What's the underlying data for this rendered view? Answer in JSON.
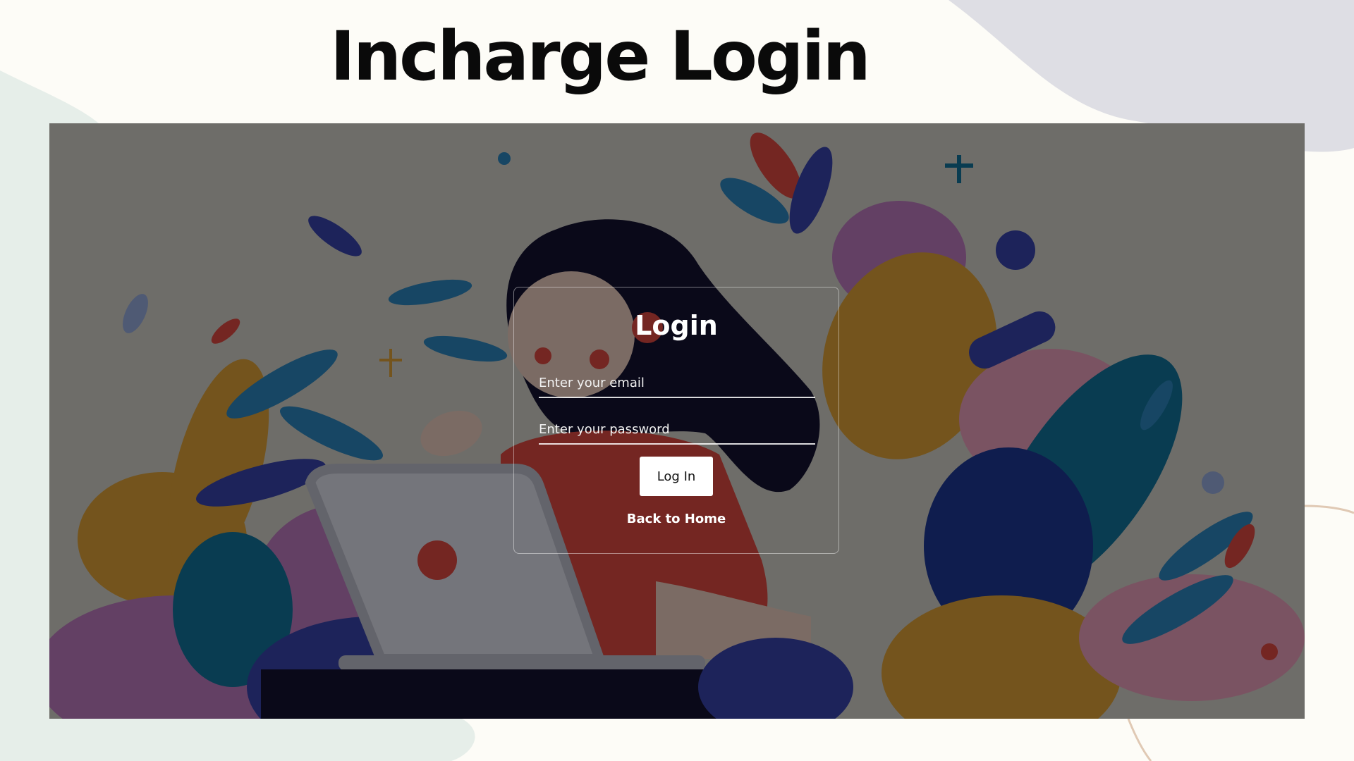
{
  "page": {
    "title": "Incharge Login"
  },
  "login_card": {
    "heading": "Login",
    "email_placeholder": "Enter your email",
    "email_value": "",
    "password_placeholder": "Enter your password",
    "password_value": "",
    "submit_label": "Log In",
    "back_link_label": "Back to Home"
  },
  "colors": {
    "page_background": "#fdfcf7",
    "overlay": "rgba(0,0,0,0.5)",
    "button_background": "#ffffff",
    "text_on_dark": "#ffffff"
  },
  "icons": {
    "hero": "woman-with-laptop-illustration"
  }
}
